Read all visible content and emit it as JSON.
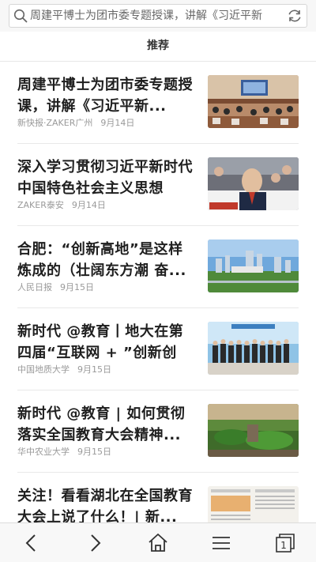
{
  "search": {
    "text": "周建平博士为团市委专题授课，讲解《习近平新",
    "icon": "search-icon",
    "refresh_icon": "refresh-icon"
  },
  "tabs": [
    {
      "label": "推荐",
      "active": true
    }
  ],
  "feed": [
    {
      "title": "周建平博士为团市委专题授课，讲解《习近平新...",
      "source": "新快报·ZAKER广州",
      "date": "9月14日",
      "thumb": "meeting-room-photo"
    },
    {
      "title": "深入学习贯彻习近平新时代中国特色社会主义思想",
      "source": "ZAKER泰安",
      "date": "9月14日",
      "thumb": "lecture-audience-photo"
    },
    {
      "title": "合肥：“创新高地”是这样炼成的（壮阔东方潮 奋...",
      "source": "人民日报",
      "date": "9月15日",
      "thumb": "city-skyline-photo"
    },
    {
      "title": "新时代 @教育丨地大在第四届“互联网 + ”创新创业...",
      "source": "中国地质大学",
      "date": "9月15日",
      "thumb": "group-photo"
    },
    {
      "title": "新时代 @教育 | 如何贯彻落实全国教育大会精神...",
      "source": "华中农业大学",
      "date": "9月15日",
      "thumb": "campus-garden-photo"
    },
    {
      "title": "关注！看看湖北在全国教育大会上说了什么！| 新...",
      "source": "",
      "date": "",
      "thumb": "newspaper-page-photo"
    }
  ],
  "bottom_nav": {
    "back_icon": "back-arrow-icon",
    "forward_icon": "forward-arrow-icon",
    "home_icon": "home-icon",
    "menu_icon": "menu-icon",
    "tabs_icon": "tabs-icon",
    "tabs_count": "1"
  },
  "colors": {
    "title_text": "#1f1f1f",
    "meta_text": "#9a9a9a",
    "divider": "#e8e8e8",
    "toolbar_icon": "#333333"
  }
}
